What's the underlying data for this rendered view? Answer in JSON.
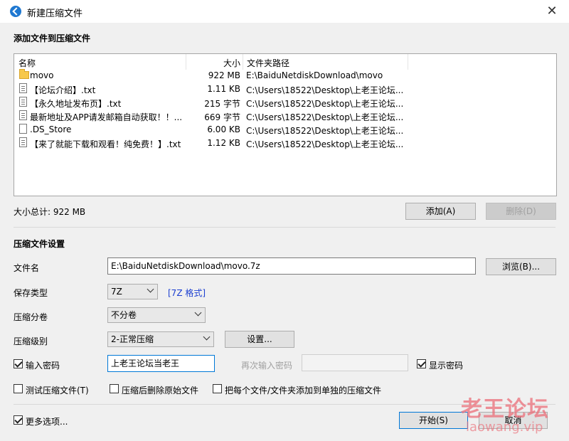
{
  "window": {
    "title": "新建压缩文件",
    "close_glyph": "✕"
  },
  "files_section": {
    "title": "添加文件到压缩文件",
    "columns": {
      "name": "名称",
      "size": "大小",
      "path": "文件夹路径"
    },
    "rows": [
      {
        "icon": "folder-icon",
        "name": "movo",
        "size": "922 MB",
        "path": "E:\\BaiduNetdiskDownload\\movo"
      },
      {
        "icon": "text-file-icon",
        "name": "【论坛介绍】.txt",
        "size": "1.11 KB",
        "path": "C:\\Users\\18522\\Desktop\\上老王论坛..."
      },
      {
        "icon": "text-file-icon",
        "name": "【永久地址发布页】.txt",
        "size": "215 字节",
        "path": "C:\\Users\\18522\\Desktop\\上老王论坛..."
      },
      {
        "icon": "text-file-icon",
        "name": "最新地址及APP请发邮箱自动获取！！...",
        "size": "669 字节",
        "path": "C:\\Users\\18522\\Desktop\\上老王论坛..."
      },
      {
        "icon": "file-icon",
        "name": ".DS_Store",
        "size": "6.00 KB",
        "path": "C:\\Users\\18522\\Desktop\\上老王论坛..."
      },
      {
        "icon": "text-file-icon",
        "name": "【来了就能下载和观看！纯免费！】.txt",
        "size": "1.12 KB",
        "path": "C:\\Users\\18522\\Desktop\\上老王论坛..."
      }
    ],
    "total_size": "大小总计: 922 MB",
    "add_button": "添加(A)",
    "delete_button": "删除(D)"
  },
  "settings": {
    "title": "压缩文件设置",
    "filename_label": "文件名",
    "filename_value": "E:\\BaiduNetdiskDownload\\movo.7z",
    "browse_button": "浏览(B)...",
    "save_type_label": "保存类型",
    "save_type_value": "7Z",
    "format_link": "[7Z 格式]",
    "split_label": "压缩分卷",
    "split_value": "不分卷",
    "level_label": "压缩级别",
    "level_value": "2-正常压缩",
    "settings_button": "设置...",
    "password_label": "输入密码",
    "password_checked": true,
    "password_value": "上老王论坛当老王",
    "reenter_label": "再次输入密码",
    "show_password_label": "显示密码",
    "show_password_checked": true,
    "test_label": "测试压缩文件(T)",
    "delete_after_label": "压缩后删除原始文件",
    "each_file_label": "把每个文件/文件夹添加到单独的压缩文件"
  },
  "footer": {
    "more_options_label": "更多选项...",
    "more_options_checked": true,
    "start_button": "开始(S)",
    "cancel_button": "取消"
  },
  "watermark": {
    "text": "老王论坛",
    "url": "laowang.vip"
  }
}
